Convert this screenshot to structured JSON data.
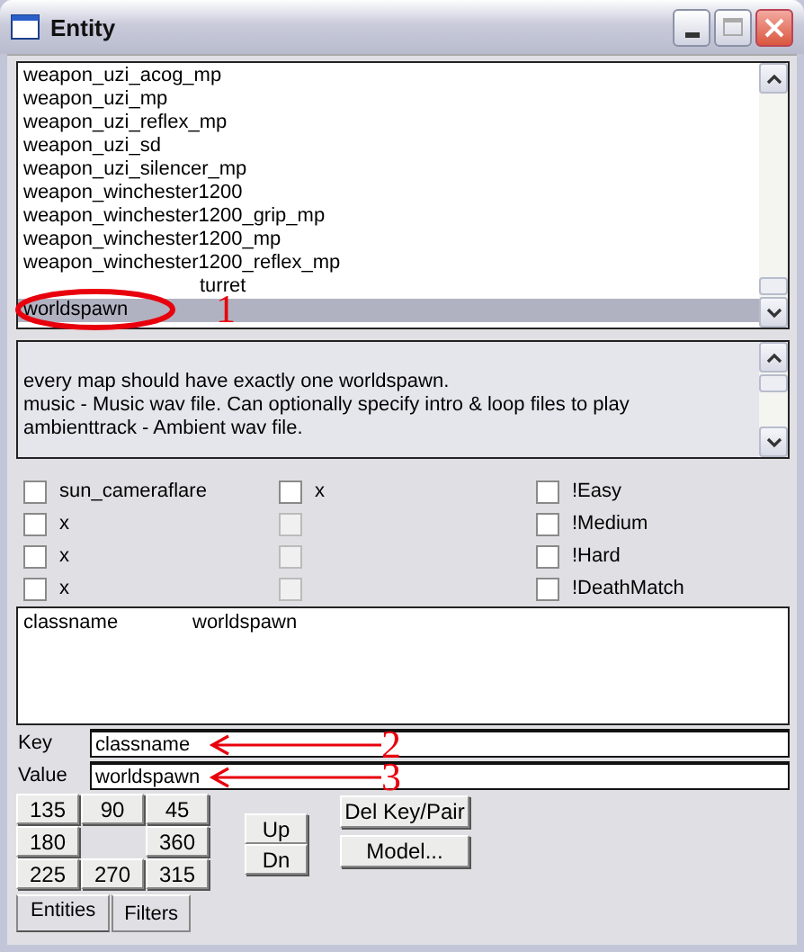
{
  "window": {
    "title": "Entity"
  },
  "entity_list": {
    "items": [
      {
        "text": "weapon_uzi_acog_mp",
        "selected": false,
        "kind": "plain"
      },
      {
        "text": "weapon_uzi_mp",
        "selected": false,
        "kind": "plain"
      },
      {
        "text": "weapon_uzi_reflex_mp",
        "selected": false,
        "kind": "plain"
      },
      {
        "text": "weapon_uzi_sd",
        "selected": false,
        "kind": "plain"
      },
      {
        "text": "weapon_uzi_silencer_mp",
        "selected": false,
        "kind": "plain"
      },
      {
        "text": "weapon_winchester1200",
        "selected": false,
        "kind": "plain"
      },
      {
        "text": "weapon_winchester1200_grip_mp",
        "selected": false,
        "kind": "plain"
      },
      {
        "text": "weapon_winchester1200_mp",
        "selected": false,
        "kind": "plain"
      },
      {
        "text": "weapon_winchester1200_reflex_mp",
        "selected": false,
        "kind": "plain"
      },
      {
        "text": "turret",
        "selected": false,
        "kind": "covered"
      },
      {
        "text": "worldspawn",
        "selected": true,
        "kind": "plain"
      }
    ]
  },
  "description": [
    "every map should have exactly one worldspawn.",
    "music -  Music wav file. Can optionally specify intro & loop files to play",
    "ambienttrack -  Ambient wav file."
  ],
  "flags": [
    {
      "label": "sun_cameraflare",
      "checked": false,
      "disabled": false
    },
    {
      "label": "x",
      "checked": false,
      "disabled": false
    },
    {
      "label": "!Easy",
      "checked": false,
      "disabled": false
    },
    {
      "label": "x",
      "checked": false,
      "disabled": false
    },
    {
      "checked": false,
      "disabled": true
    },
    {
      "label": "!Medium",
      "checked": false,
      "disabled": false
    },
    {
      "label": "x",
      "checked": false,
      "disabled": false
    },
    {
      "checked": false,
      "disabled": true
    },
    {
      "label": "!Hard",
      "checked": false,
      "disabled": false
    },
    {
      "label": "x",
      "checked": false,
      "disabled": false
    },
    {
      "checked": false,
      "disabled": true
    },
    {
      "label": "!DeathMatch",
      "checked": false,
      "disabled": false
    }
  ],
  "properties": [
    {
      "key": "classname",
      "value": "worldspawn"
    }
  ],
  "key_field": {
    "label": "Key",
    "value": "classname"
  },
  "value_field": {
    "label": "Value",
    "value": "worldspawn"
  },
  "angle_buttons": [
    {
      "kind": "button",
      "label": "135"
    },
    {
      "kind": "button",
      "label": "90"
    },
    {
      "kind": "button",
      "label": "45"
    },
    {
      "kind": "button",
      "label": "180"
    },
    {
      "kind": "gap"
    },
    {
      "kind": "button",
      "label": "360"
    },
    {
      "kind": "button",
      "label": "225"
    },
    {
      "kind": "button",
      "label": "270"
    },
    {
      "kind": "button",
      "label": "315"
    }
  ],
  "order_buttons": [
    "Up",
    "Dn"
  ],
  "action_buttons": [
    "Del Key/Pair",
    "Model..."
  ],
  "tabs": [
    {
      "label": "Entities",
      "selected": true
    },
    {
      "label": "Filters",
      "selected": false
    }
  ],
  "annotations": [
    {
      "kind": "ellipse",
      "label": "1"
    },
    {
      "kind": "arrow",
      "label": "2"
    },
    {
      "kind": "arrow",
      "label": "3"
    }
  ]
}
